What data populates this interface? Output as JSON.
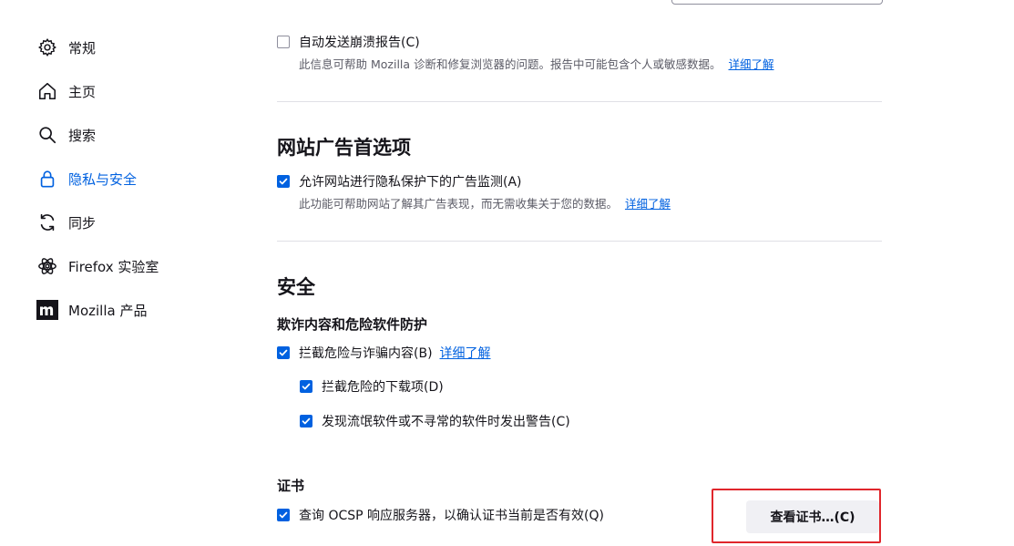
{
  "sidebar": {
    "items": [
      {
        "label": "常规",
        "icon": "gear-icon"
      },
      {
        "label": "主页",
        "icon": "home-icon"
      },
      {
        "label": "搜索",
        "icon": "search-icon"
      },
      {
        "label": "隐私与安全",
        "icon": "lock-icon",
        "active": true
      },
      {
        "label": "同步",
        "icon": "sync-icon"
      },
      {
        "label": "Firefox 实验室",
        "icon": "flask-icon"
      },
      {
        "label": "Mozilla 产品",
        "icon": "mozilla-logo-icon"
      }
    ]
  },
  "crash": {
    "checkbox_label": "自动发送崩溃报告(C)",
    "checked": false,
    "desc": "此信息可帮助 Mozilla 诊断和修复浏览器的问题。报告中可能包含个人或敏感数据。",
    "learn_more": "详细了解"
  },
  "ads": {
    "heading": "网站广告首选项",
    "checkbox_label": "允许网站进行隐私保护下的广告监测(A)",
    "checked": true,
    "desc": "此功能可帮助网站了解其广告表现，而无需收集关于您的数据。",
    "learn_more": "详细了解"
  },
  "security": {
    "heading": "安全",
    "subheading": "欺诈内容和危险软件防护",
    "block_label": "拦截危险与诈骗内容(B)",
    "block_checked": true,
    "learn_more": "详细了解",
    "downloads_label": "拦截危险的下载项(D)",
    "downloads_checked": true,
    "unwanted_label": "发现流氓软件或不寻常的软件时发出警告(C)",
    "unwanted_checked": true
  },
  "certs": {
    "heading": "证书",
    "ocsp_label": "查询 OCSP 响应服务器，以确认证书当前是否有效(Q)",
    "ocsp_checked": true,
    "view_button": "查看证书…(C)"
  },
  "colors": {
    "accent": "#0061e0",
    "highlight": "#e0262c"
  }
}
